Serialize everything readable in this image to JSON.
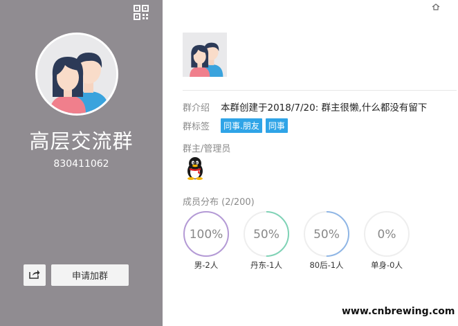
{
  "left_panel": {
    "group_name": "高层交流群",
    "group_id": "830411062",
    "join_button": "申请加群"
  },
  "info": {
    "intro_label": "群介绍",
    "intro_text": "本群创建于2018/7/20:  群主很懒,什么都没有留下",
    "tags_label": "群标签",
    "tags": [
      "同事.朋友",
      "同事"
    ],
    "admins_label": "群主/管理员",
    "members_label": "成员分布 (2/200)"
  },
  "distribution": [
    {
      "percent_text": "100%",
      "value": 1.0,
      "label": "男-2人",
      "color": "#b49ad6"
    },
    {
      "percent_text": "50%",
      "value": 0.5,
      "label": "丹东-1人",
      "color": "#7fd3b6"
    },
    {
      "percent_text": "50%",
      "value": 0.5,
      "label": "80后-1人",
      "color": "#8fb6e6"
    },
    {
      "percent_text": "0%",
      "value": 0.0,
      "label": "单身-0人",
      "color": "#dcdcdc"
    }
  ],
  "footer": {
    "watermark": "www.cnbrewing.com"
  },
  "icons": {
    "qr": "qr-code-icon",
    "share": "share-icon",
    "home": "home-icon",
    "admin_avatar": "qq-penguin-icon"
  },
  "colors": {
    "left_bg": "#908c91",
    "tag_bg": "#2fa4e7"
  }
}
